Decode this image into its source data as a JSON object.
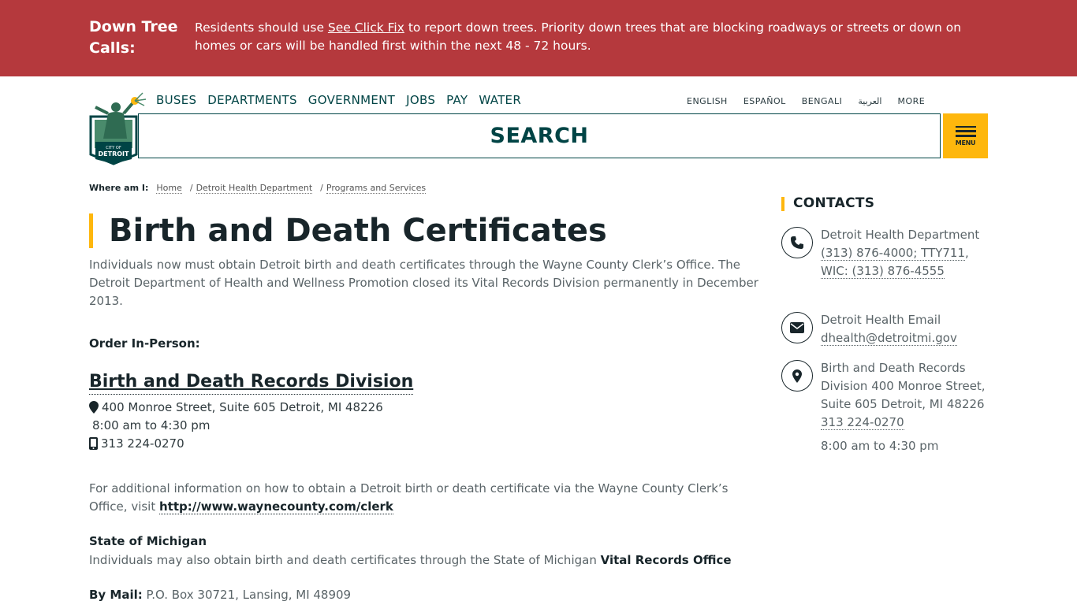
{
  "alert": {
    "title": "Down Tree Calls:",
    "text_before": "Residents should use ",
    "link": "See Click Fix",
    "text_after": " to report down trees. Priority down trees that are blocking roadways or streets or down on homes or cars will be handled first within the next 48 - 72 hours."
  },
  "logo": {
    "line1": "CITY OF",
    "line2": "DETROIT"
  },
  "topnav": [
    "BUSES",
    "DEPARTMENTS",
    "GOVERNMENT",
    "JOBS",
    "PAY",
    "WATER"
  ],
  "languages": [
    "ENGLISH",
    "ESPAÑOL",
    "BENGALI",
    "العربية",
    "MORE"
  ],
  "search": {
    "label": "SEARCH"
  },
  "menu": {
    "label": "MENU"
  },
  "breadcrumb": {
    "label": "Where am I:",
    "items": [
      "Home",
      "Detroit Health Department",
      "Programs and Services"
    ]
  },
  "page": {
    "title": "Birth and Death Certificates",
    "intro": "Individuals now must obtain Detroit birth and death certificates through the Wayne County Clerk’s Office. The Detroit Department of Health and Wellness Promotion closed its Vital Records Division permanently in December 2013.",
    "order_label": "Order In-Person:",
    "division_title": "Birth and Death Records Division",
    "address": "400 Monroe Street, Suite 605 Detroit, MI 48226",
    "hours": "8:00 am to 4:30 pm",
    "phone": "313 224-0270",
    "additional_text": "For additional information on how to obtain a Detroit birth or death certificate via the Wayne County Clerk’s Office, visit ",
    "additional_link": "http://www.waynecounty.com/clerk",
    "state_title": "State of Michigan",
    "state_text": "Individuals may also obtain birth and death certificates through the State of Michigan ",
    "state_link": "Vital Records Office",
    "mail_label": "By Mail:",
    "mail_text": " P.O. Box 30721, Lansing, MI 48909"
  },
  "contacts": {
    "title": "CONTACTS",
    "phone_name": "Detroit Health Department",
    "phone_link1": "(313) 876-4000; TTY711",
    "phone_sep": ",",
    "phone_link2": "WIC: (313) 876-4555",
    "email_name": "Detroit Health Email",
    "email_link": "dhealth@detroitmi.gov",
    "location_text": "Birth and Death Records Division 400 Monroe Street, Suite 605 Detroit, MI 48226 ",
    "location_phone": "313 224-0270",
    "location_hours": "8:00 am to 4:30 pm"
  },
  "colors": {
    "alert_bg": "#b5393d",
    "accent": "#feb70d",
    "brand": "#004445",
    "text": "#18252a"
  }
}
